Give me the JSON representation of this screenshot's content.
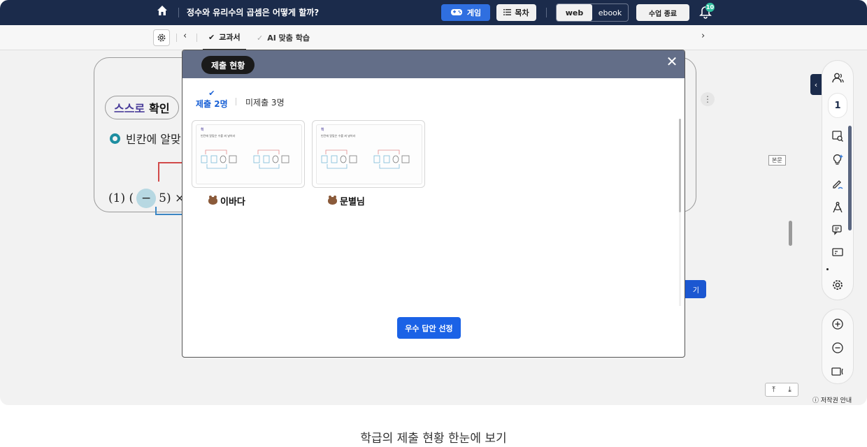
{
  "topbar": {
    "lesson_title": "정수와 유리수의 곱셈은 어떻게 할까?",
    "game_label": "게임",
    "toc_label": "목차",
    "view_web": "web",
    "view_ebook": "ebook",
    "end_class_label": "수업 종료",
    "notification_count": "10"
  },
  "subbar": {
    "tab_textbook": "교과서",
    "tab_ai": "AI 맞춤 학습"
  },
  "content": {
    "self_check_a": "스스로",
    "self_check_b": "확인",
    "prompt": "빈칸에 알맞",
    "math_prefix": "(1) (",
    "math_blank": "−",
    "math_suffix": "5) ×",
    "action_peek": "기",
    "body_tag": "본문"
  },
  "rail": {
    "student_count": "1",
    "copyright": "저작권 안내"
  },
  "modal": {
    "title": "제출 현황",
    "tab_submitted": "제출 2명",
    "tab_unsubmitted": "미제출 3명",
    "select_best_label": "우수 답안 선정",
    "submissions": [
      {
        "name": "이바다",
        "thumb_tag": "확",
        "thumb_line": "빈칸에 알맞은 수를 써 넣어라"
      },
      {
        "name": "문별님",
        "thumb_tag": "확",
        "thumb_line": "빈칸에 알맞은 수를 써 넣어라"
      }
    ]
  },
  "caption": "학급의 제출 현황 한눈에 보기",
  "icons": {
    "home": "home-icon",
    "game": "gamepad-icon",
    "toc": "list-icon",
    "bell": "bell-icon",
    "settings": "gear-icon",
    "close": "close-icon"
  },
  "colors": {
    "topbar": "#1b2b4b",
    "accent": "#1b62e6",
    "modal_header": "#636e88",
    "badge": "#30c1a0"
  }
}
